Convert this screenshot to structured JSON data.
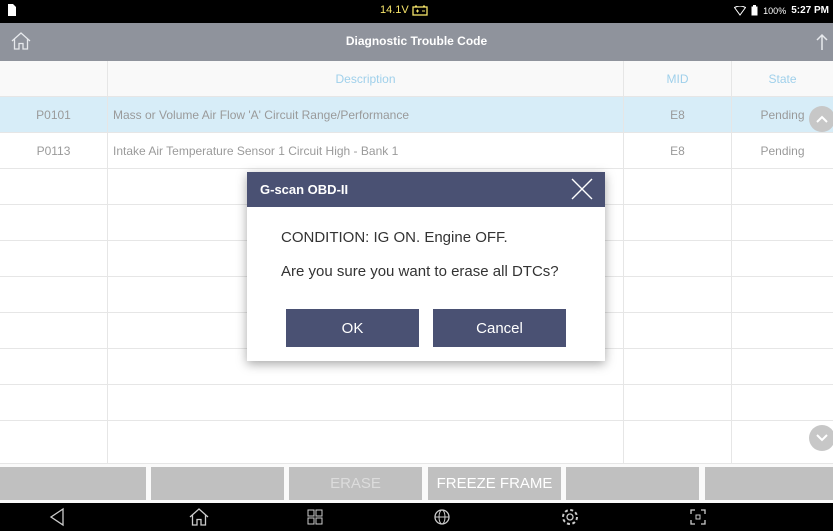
{
  "status_bar": {
    "voltage": "14.1V",
    "battery_percent": "100%",
    "time": "5:27 PM"
  },
  "title_bar": {
    "title": "Diagnostic Trouble Code"
  },
  "table": {
    "columns": [
      "",
      "Description",
      "MID",
      "State"
    ],
    "rows": [
      {
        "code": "P0101",
        "description": "Mass or Volume Air Flow 'A' Circuit Range/Performance",
        "mid": "E8",
        "state": "Pending",
        "selected": true
      },
      {
        "code": "P0113",
        "description": "Intake Air Temperature Sensor 1 Circuit High - Bank 1",
        "mid": "E8",
        "state": "Pending",
        "selected": false
      }
    ],
    "empty_rows": 8
  },
  "bottom_bar": {
    "erase_label": "ERASE",
    "freeze_frame_label": "FREEZE FRAME"
  },
  "dialog": {
    "title": "G-scan OBD-II",
    "condition": "CONDITION: IG ON. Engine OFF.",
    "question": "Are you sure you want to erase all DTCs?",
    "ok_label": "OK",
    "cancel_label": "Cancel"
  },
  "colors": {
    "title_bar_bg": "#1f2738",
    "header_text": "#3ea0d6",
    "selected_row_bg": "#aedaf0",
    "dialog_accent": "#4a5173",
    "button_gray": "#808080"
  },
  "icons": {
    "status_left": "sim-card-icon",
    "status_voltage": "car-battery-icon",
    "status_wifi": "wifi-icon",
    "status_battery": "battery-icon",
    "home": "home-icon",
    "upload": "upload-icon",
    "scroll_up": "chevron-up-icon",
    "scroll_down": "chevron-down-icon",
    "dialog_close": "close-icon",
    "nav_back": "back-icon",
    "nav_home": "home-icon",
    "nav_apps": "apps-grid-icon",
    "nav_web": "globe-icon",
    "nav_settings": "gear-icon",
    "nav_capture": "screen-capture-icon"
  }
}
